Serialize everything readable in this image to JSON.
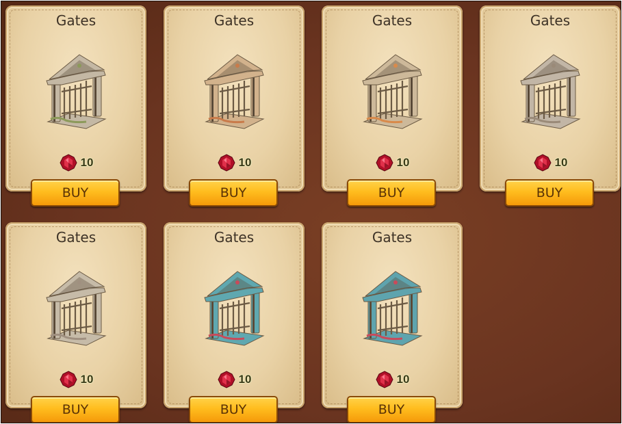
{
  "shop": {
    "items": [
      {
        "title": "Gates",
        "price": "10",
        "buy_label": "BUY",
        "variant": "stone-green",
        "stone": "#c4b8a4",
        "accent": "#8c9a5a"
      },
      {
        "title": "Gates",
        "price": "10",
        "buy_label": "BUY",
        "variant": "terracotta",
        "stone": "#d2b28c",
        "accent": "#c97b4a"
      },
      {
        "title": "Gates",
        "price": "10",
        "buy_label": "BUY",
        "variant": "stone-orange",
        "stone": "#cdb99a",
        "accent": "#d98a4a"
      },
      {
        "title": "Gates",
        "price": "10",
        "buy_label": "BUY",
        "variant": "stone-grey",
        "stone": "#c2b6a6",
        "accent": "#9a8a78"
      },
      {
        "title": "Gates",
        "price": "10",
        "buy_label": "BUY",
        "variant": "stone-plain",
        "stone": "#c6bba8",
        "accent": "#a09080"
      },
      {
        "title": "Gates",
        "price": "10",
        "buy_label": "BUY",
        "variant": "teal-roses",
        "stone": "#5fa8b0",
        "accent": "#c94a5a"
      },
      {
        "title": "Gates",
        "price": "10",
        "buy_label": "BUY",
        "variant": "teal-roses",
        "stone": "#5ea4ae",
        "accent": "#c94a5a"
      }
    ]
  },
  "colors": {
    "background": "#6a3420",
    "card": "#e9d2a6",
    "button": "#ffbd1e",
    "gem": "#c8102e"
  },
  "icons": {
    "currency": "ruby-gem-icon",
    "item": "gate-icon"
  }
}
